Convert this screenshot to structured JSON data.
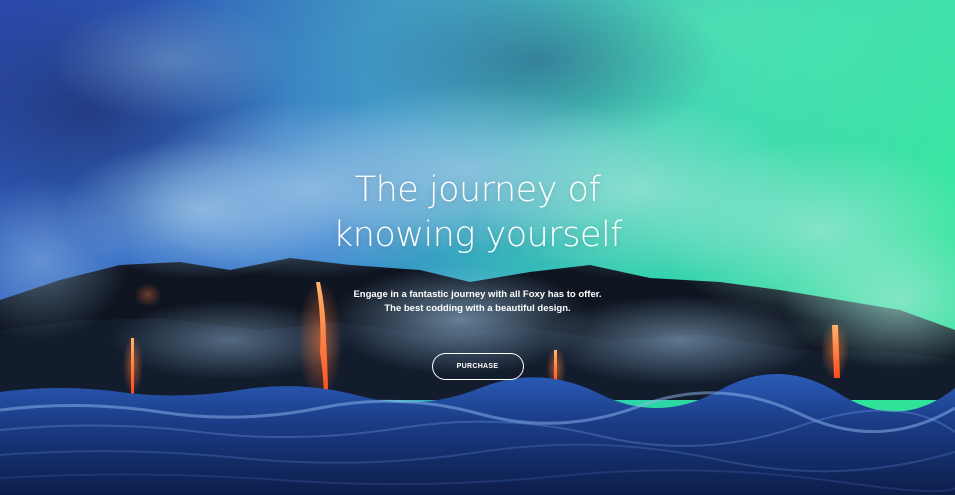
{
  "hero": {
    "title_line1": "The journey of",
    "title_line2": "knowing yourself",
    "subtitle_line1": "Engage in a fantastic journey with all Foxy has to offer.",
    "subtitle_line2": "The best codding with a beautiful design.",
    "cta_label": "PURCHASE"
  },
  "colors": {
    "sky_top_left": "#2a4fb8",
    "sky_top_right": "#2ee8a0",
    "rock": "#0e1420",
    "lava": "#ff6a2a",
    "sea": "#1b3c86",
    "text": "#ffffff"
  }
}
